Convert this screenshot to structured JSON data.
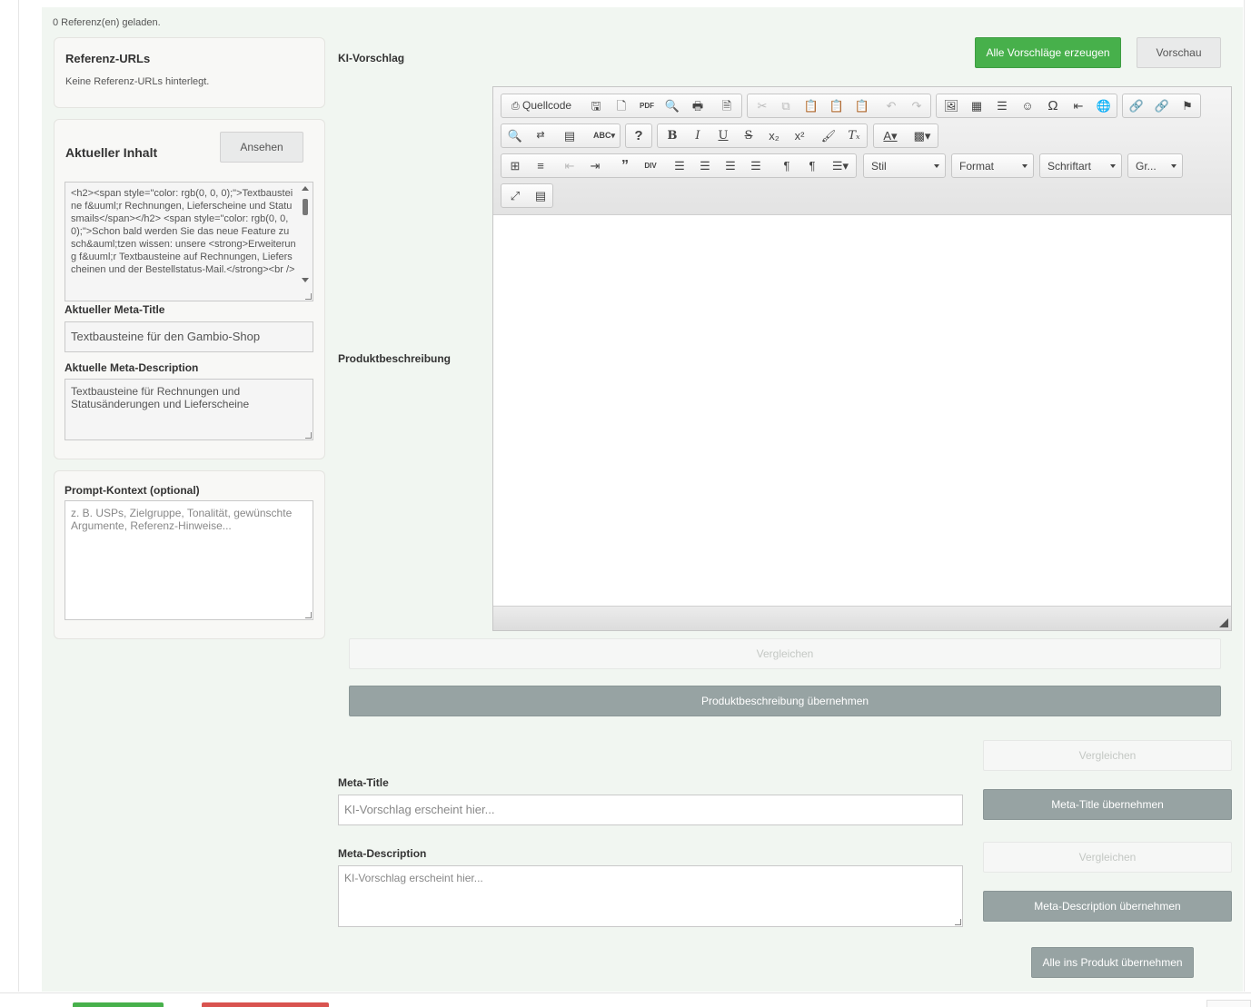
{
  "status_text": "0 Referenz(en) geladen.",
  "refs": {
    "title": "Referenz-URLs",
    "empty_text": "Keine Referenz-URLs hinterlegt."
  },
  "current": {
    "title": "Aktueller Inhalt",
    "view_button": "Ansehen",
    "html_content": "<h2><span style=\"color: rgb(0, 0, 0);\">Textbausteine f&uuml;r Rechnungen, Lieferscheine und Statusmails</span></h2> <span style=\"color: rgb(0, 0, 0);\">Schon bald werden Sie das neue Feature zu sch&auml;tzen wissen: unsere <strong>Erweiterung f&uuml;r Textbausteine auf Rechnungen, Lieferscheinen und der Bestellstatus-Mail.</strong><br />",
    "meta_title_label": "Aktueller Meta-Title",
    "meta_title_value": "Textbausteine für den Gambio-Shop",
    "meta_desc_label": "Aktuelle Meta-Description",
    "meta_desc_value": "Textbausteine für Rechnungen und Statusänderungen und Lieferscheine"
  },
  "prompt": {
    "label": "Prompt-Kontext (optional)",
    "placeholder": "z. B. USPs, Zielgruppe, Tonalität, gewünschte Argumente, Referenz-Hinweise..."
  },
  "ki": {
    "heading": "KI-Vorschlag",
    "generate_all": "Alle Vorschläge erzeugen",
    "preview": "Vorschau",
    "product_desc_label": "Produktbeschreibung",
    "compare": "Vergleichen",
    "apply_desc": "Produktbeschreibung übernehmen",
    "meta_title_label": "Meta-Title",
    "meta_title_placeholder": "KI-Vorschlag erscheint hier...",
    "apply_meta_title": "Meta-Title übernehmen",
    "meta_desc_label": "Meta-Description",
    "meta_desc_placeholder": "KI-Vorschlag erscheint hier...",
    "apply_meta_desc": "Meta-Description übernehmen",
    "apply_all": "Alle ins Produkt übernehmen"
  },
  "editor": {
    "source_label": "Quellcode",
    "style_combo": "Stil",
    "format_combo": "Format",
    "font_combo": "Schriftart",
    "size_combo": "Gr..."
  },
  "colors": {
    "green": "#47b04b",
    "gray_button": "#97a3a3",
    "panel_bg": "#f1f6f1"
  }
}
